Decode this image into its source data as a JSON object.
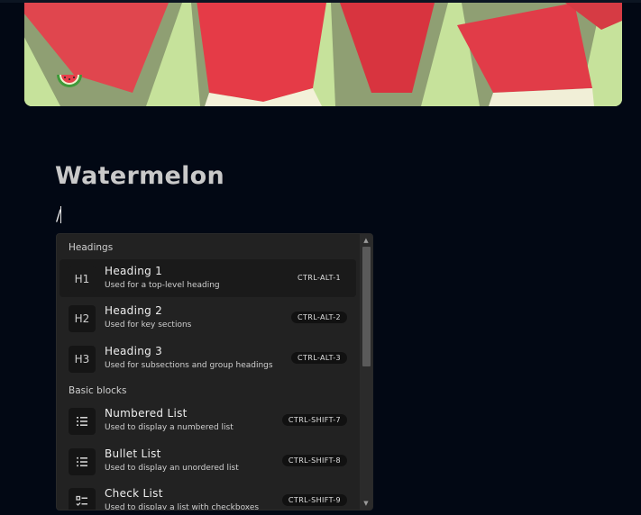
{
  "page": {
    "title": "Watermelon",
    "input_text": "/"
  },
  "cover": {
    "emoji": "watermelon-icon"
  },
  "slash_menu": {
    "groups": [
      {
        "label": "Headings",
        "items": [
          {
            "icon_text": "H1",
            "icon": "heading-1-icon",
            "title": "Heading 1",
            "description": "Used for a top-level heading",
            "shortcut": "CTRL-ALT-1",
            "active": true
          },
          {
            "icon_text": "H2",
            "icon": "heading-2-icon",
            "title": "Heading 2",
            "description": "Used for key sections",
            "shortcut": "CTRL-ALT-2"
          },
          {
            "icon_text": "H3",
            "icon": "heading-3-icon",
            "title": "Heading 3",
            "description": "Used for subsections and group headings",
            "shortcut": "CTRL-ALT-3"
          }
        ]
      },
      {
        "label": "Basic blocks",
        "items": [
          {
            "icon": "numbered-list-icon",
            "title": "Numbered List",
            "description": "Used to display a numbered list",
            "shortcut": "CTRL-SHIFT-7"
          },
          {
            "icon": "bullet-list-icon",
            "title": "Bullet List",
            "description": "Used to display an unordered list",
            "shortcut": "CTRL-SHIFT-8"
          },
          {
            "icon": "checklist-icon",
            "title": "Check List",
            "description": "Used to display a list with checkboxes",
            "shortcut": "CTRL-SHIFT-9"
          }
        ]
      }
    ]
  }
}
